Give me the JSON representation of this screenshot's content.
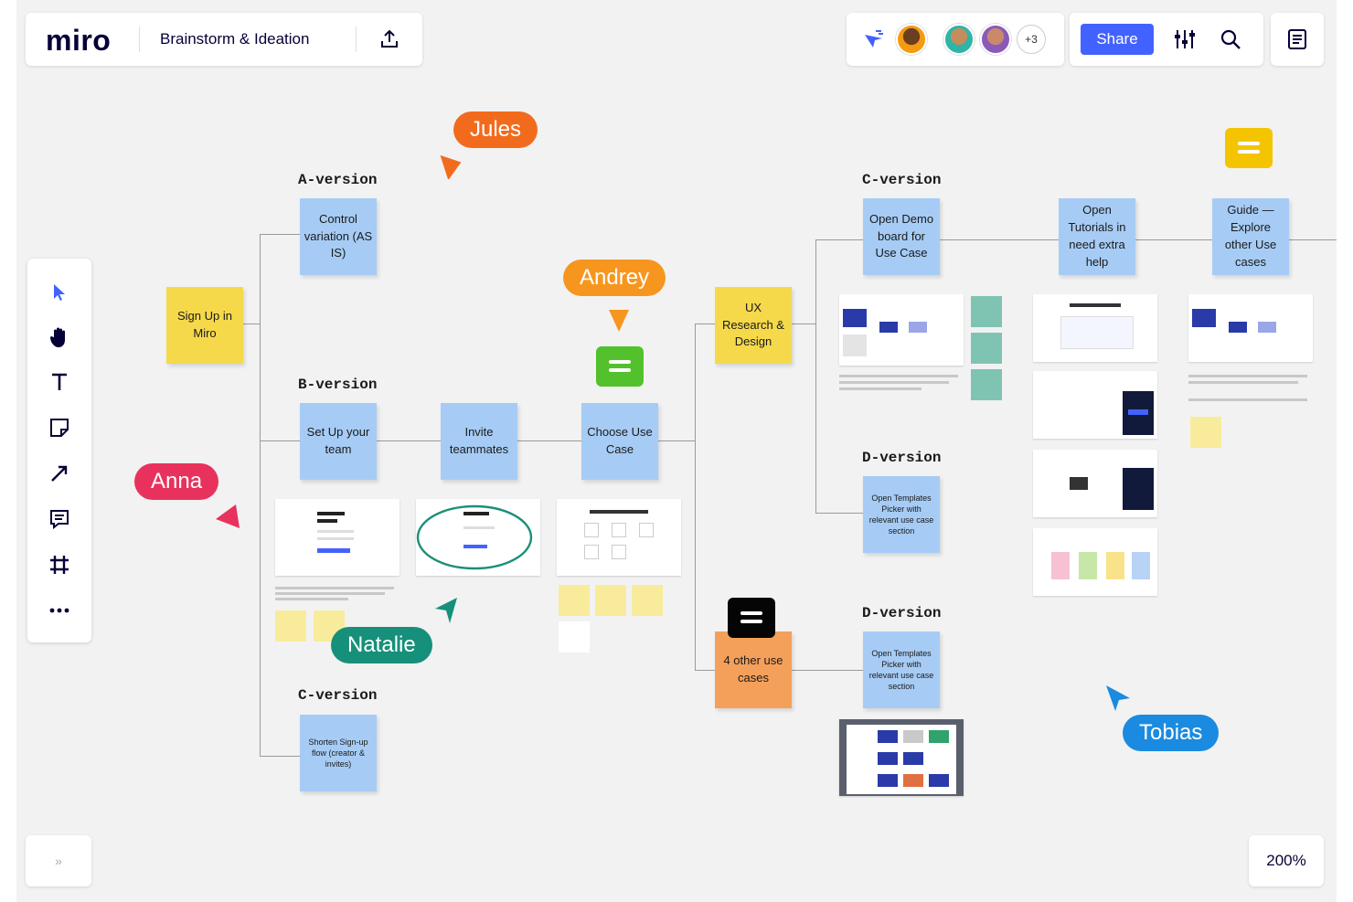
{
  "app": {
    "logo": "miro",
    "board_title": "Brainstorm & Ideation",
    "share_label": "Share",
    "extra_collaborators": "+3",
    "zoom_level": "200%",
    "expand_label": "»"
  },
  "labels": {
    "a_version": "A-version",
    "b_version": "B-version",
    "c_version_left": "C-version",
    "c_version_right": "C-version",
    "d_version_1": "D-version",
    "d_version_2": "D-version"
  },
  "stickies": {
    "sign_up": "Sign Up in Miro",
    "control": "Control variation (AS IS)",
    "set_up_team": "Set Up your team",
    "invite": "Invite teammates",
    "choose_use_case": "Choose Use Case",
    "shorten": "Shorten Sign-up flow (creator & invites)",
    "ux_research": "UX Research & Design",
    "other_use_cases": "4 other use cases",
    "open_demo": "Open Demo board for Use Case",
    "open_tutorials": "Open Tutorials in need extra help",
    "guide": "Guide — Explore other Use cases",
    "open_templates_1": "Open Templates Picker with relevant use case section",
    "open_templates_2": "Open Templates Picker with relevant use case section"
  },
  "cursors": {
    "jules": "Jules",
    "andrey": "Andrey",
    "anna": "Anna",
    "natalie": "Natalie",
    "tobias": "Tobias"
  },
  "colors": {
    "brand_blue": "#4262ff",
    "jules": "#f26b1d",
    "andrey": "#f7961e",
    "anna": "#e8325d",
    "natalie": "#16907a",
    "tobias": "#1a8be0",
    "sticky_blue": "#a6ccf5",
    "sticky_yellow": "#f5d94b",
    "sticky_orange": "#f5a05a"
  },
  "icons": {
    "upload": "upload-icon",
    "reactions": "reactions-icon",
    "settings": "settings-sliders-icon",
    "search": "search-icon",
    "notes": "notes-icon",
    "select": "cursor-select-icon",
    "hand": "hand-icon",
    "text": "text-icon",
    "sticky": "sticky-note-icon",
    "connector": "arrow-icon",
    "comment": "comment-icon",
    "frame": "frame-icon",
    "more": "more-icon"
  }
}
